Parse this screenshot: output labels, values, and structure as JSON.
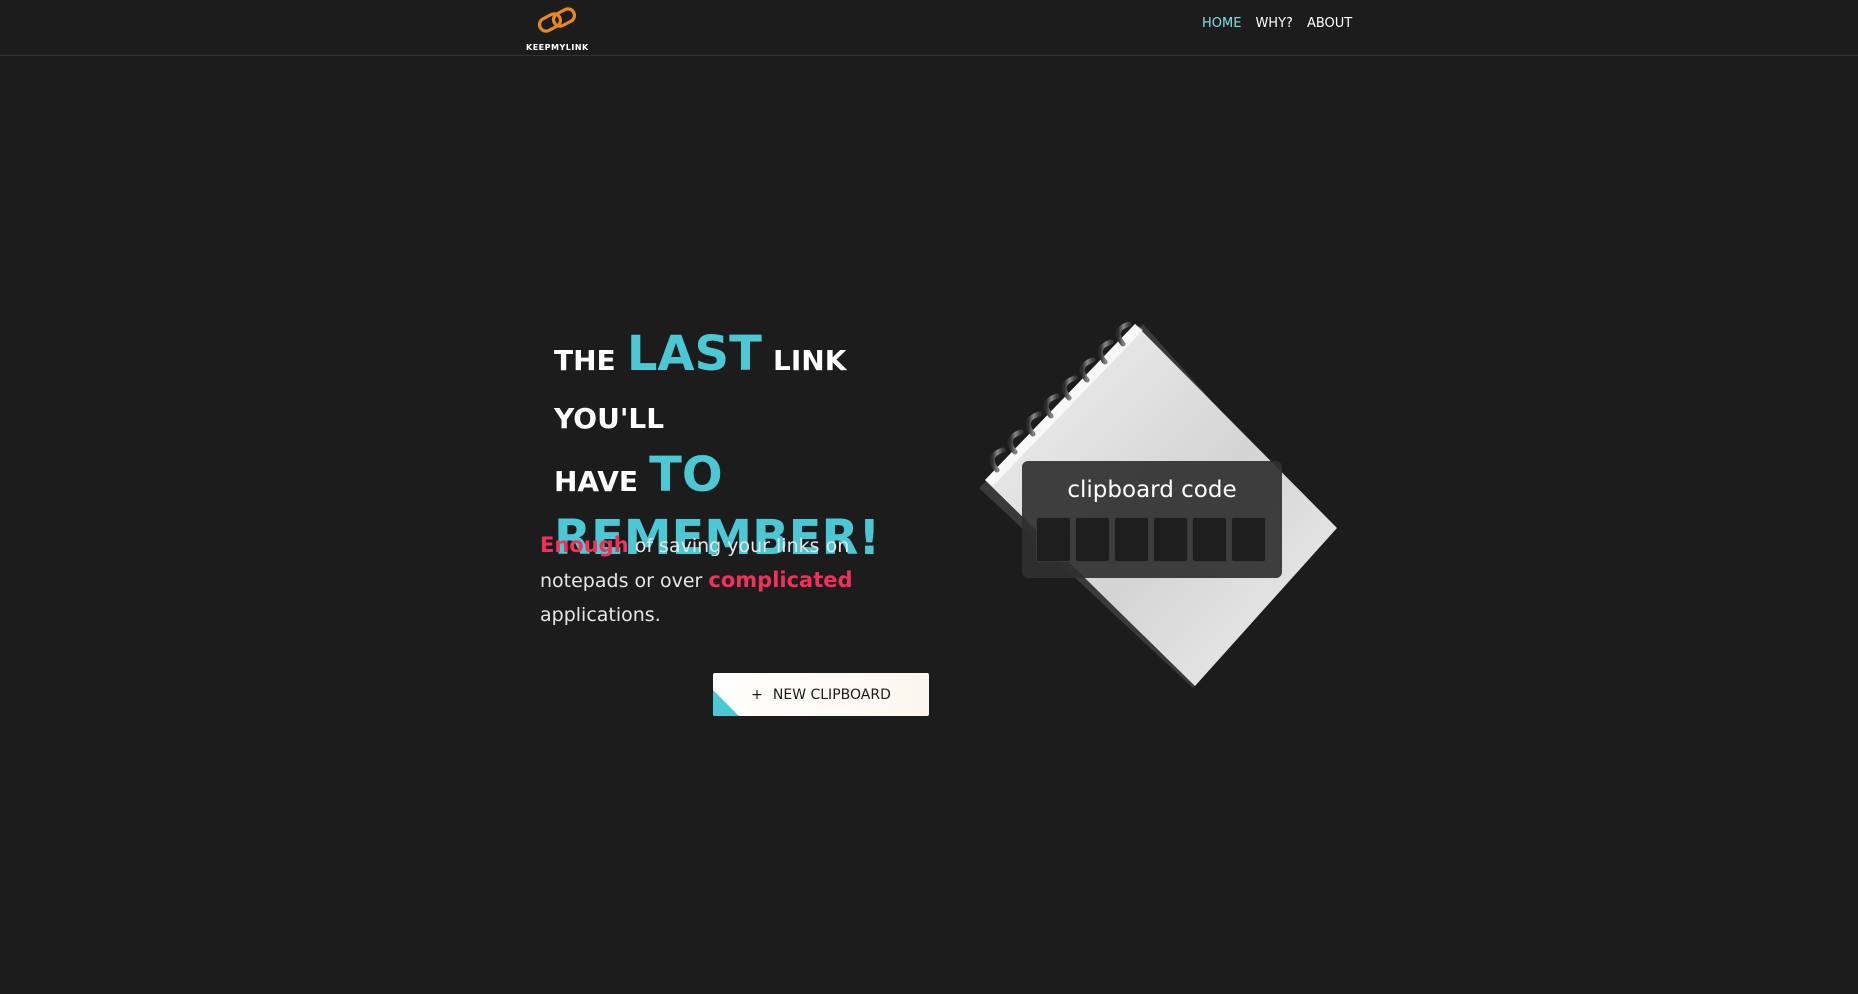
{
  "nav": {
    "logo_text": "KEEPMYLINK",
    "links": [
      {
        "label": "HOME",
        "active": true
      },
      {
        "label": "WHY?",
        "active": false
      },
      {
        "label": "ABOUT",
        "active": false
      }
    ]
  },
  "hero": {
    "title": {
      "w1": "THE",
      "w2": "LAST",
      "w3": "LINK YOU'LL",
      "w4": "HAVE",
      "w5": "TO",
      "w6": "REMEMBER!"
    },
    "sub": {
      "h1": "Enough",
      "t1": "of saving your links on notepads or over",
      "h2": "complicated",
      "t2": "applications."
    },
    "button": {
      "icon": "plus-icon",
      "label": "NEW CLIPBOARD"
    }
  },
  "clipboard": {
    "title": "clipboard code",
    "code": [
      "",
      "",
      "",
      "",
      "",
      ""
    ]
  },
  "colors": {
    "background": "#1c1c1c",
    "accent_cyan": "#4cc7d4",
    "accent_pink": "#f0325a",
    "nav_active": "#7fe0e8",
    "logo_orange": "#e8891c"
  }
}
